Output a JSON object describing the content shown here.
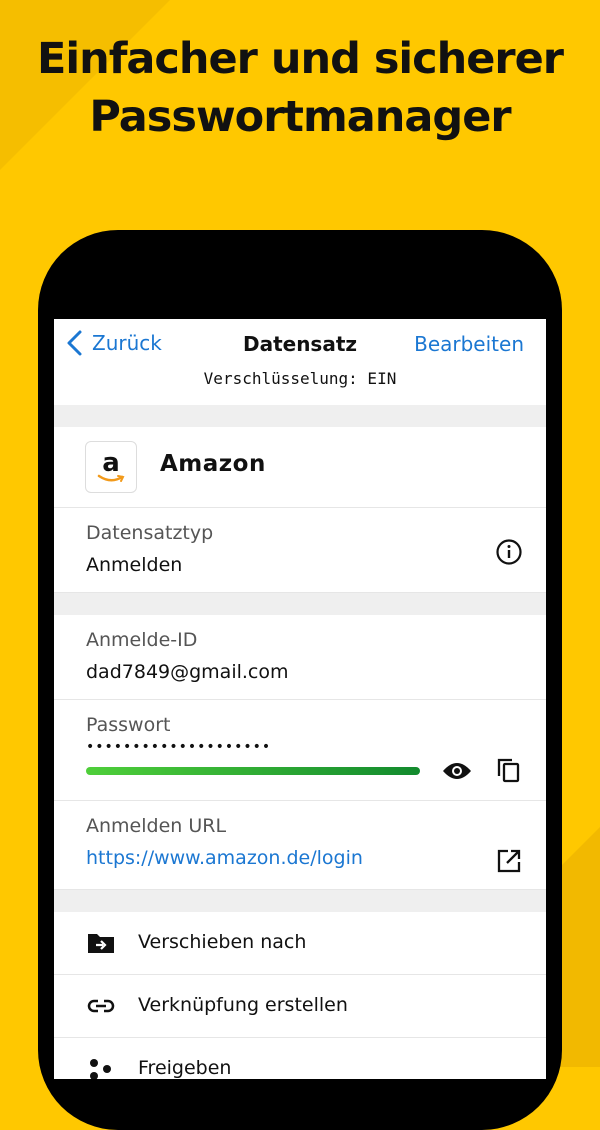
{
  "headline": {
    "line1": "Einfacher und sicherer",
    "line2": "Passwortmanager"
  },
  "navbar": {
    "back_label": "Zurück",
    "title": "Datensatz",
    "edit_label": "Bearbeiten",
    "encryption_status": "Verschlüsselung: EIN"
  },
  "record": {
    "logo_letter": "a",
    "title": "Amazon",
    "type_label": "Datensatztyp",
    "type_value": "Anmelden",
    "login_id_label": "Anmelde-ID",
    "login_id_value": "dad7849@gmail.com",
    "password_label": "Passwort",
    "password_masked": "••••••••••••••••••••",
    "password_strength": 1.0,
    "url_label": "Anmelden URL",
    "url_value": "https://www.amazon.de/login"
  },
  "actions": [
    {
      "label": "Verschieben nach",
      "icon": "folder-move-icon"
    },
    {
      "label": "Verknüpfung erstellen",
      "icon": "link-icon"
    },
    {
      "label": "Freigeben",
      "icon": "share-icon"
    }
  ],
  "colors": {
    "background": "#FFC800",
    "accent_blue": "#1B77D2",
    "strength_start": "#4FCF3A",
    "strength_end": "#128A2E"
  }
}
